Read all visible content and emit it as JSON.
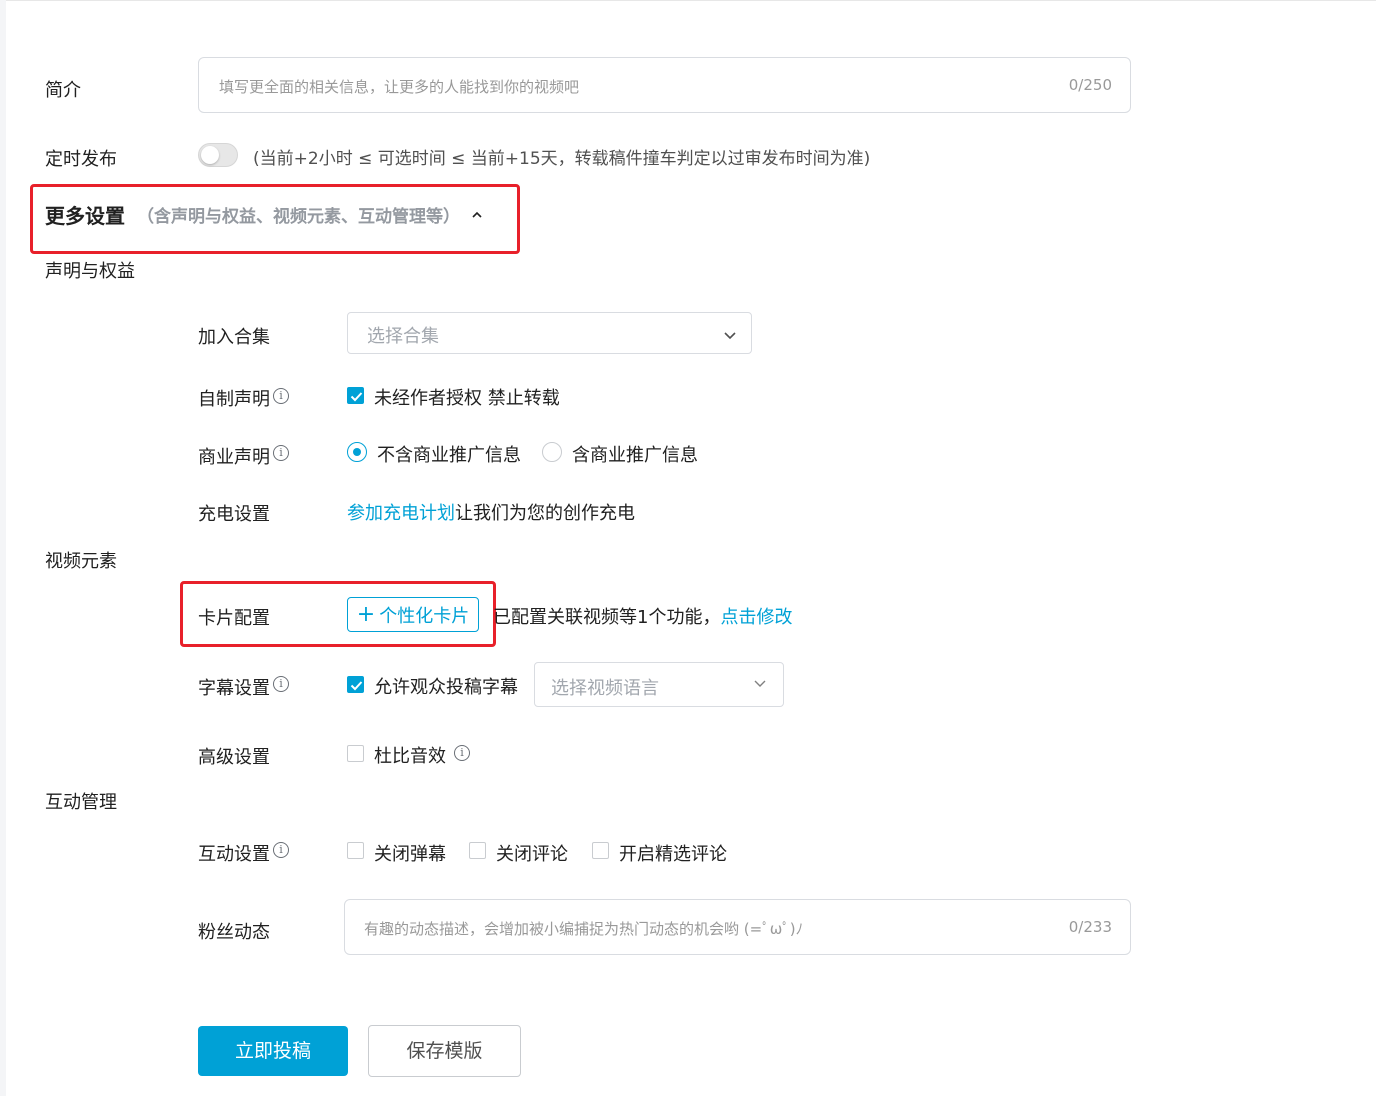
{
  "intro": {
    "label": "简介",
    "placeholder": "填写更全面的相关信息，让更多的人能找到你的视频吧",
    "counter": "0/250"
  },
  "schedule": {
    "label": "定时发布",
    "enabled": false,
    "hint": "(当前+2小时 ≤ 可选时间 ≤ 当前+15天，转载稿件撞车判定以过审发布时间为准)"
  },
  "more_settings": {
    "title": "更多设置",
    "subtitle": "（含声明与权益、视频元素、互动管理等）",
    "toggle_icon": "chevron-up-icon"
  },
  "rights": {
    "section": "声明与权益",
    "collection": {
      "label": "加入合集",
      "placeholder": "选择合集"
    },
    "self_made": {
      "label": "自制声明",
      "checked": true,
      "option": "未经作者授权 禁止转载"
    },
    "commercial": {
      "label": "商业声明",
      "options": [
        {
          "label": "不含商业推广信息",
          "selected": true
        },
        {
          "label": "含商业推广信息",
          "selected": false
        }
      ]
    },
    "charge": {
      "label": "充电设置",
      "link": "参加充电计划",
      "text": "让我们为您的创作充电"
    }
  },
  "elements": {
    "section": "视频元素",
    "card": {
      "label": "卡片配置",
      "button": "个性化卡片",
      "status": "已配置关联视频等1个功能，",
      "edit_link": "点击修改"
    },
    "subtitle": {
      "label": "字幕设置",
      "checked": true,
      "option": "允许观众投稿字幕",
      "lang_placeholder": "选择视频语言"
    },
    "advanced": {
      "label": "高级设置",
      "checked": false,
      "option": "杜比音效"
    }
  },
  "interaction": {
    "section": "互动管理",
    "settings": {
      "label": "互动设置",
      "options": [
        {
          "label": "关闭弹幕",
          "checked": false
        },
        {
          "label": "关闭评论",
          "checked": false
        },
        {
          "label": "开启精选评论",
          "checked": false
        }
      ]
    },
    "fans": {
      "label": "粉丝动态",
      "placeholder": "有趣的动态描述，会增加被小编捕捉为热门动态的机会哟 (=ﾟωﾟ)ﾉ",
      "counter": "0/233"
    }
  },
  "actions": {
    "submit": "立即投稿",
    "save_template": "保存模版"
  },
  "colors": {
    "accent": "#00a1d6",
    "highlight_box": "#e8202a"
  }
}
